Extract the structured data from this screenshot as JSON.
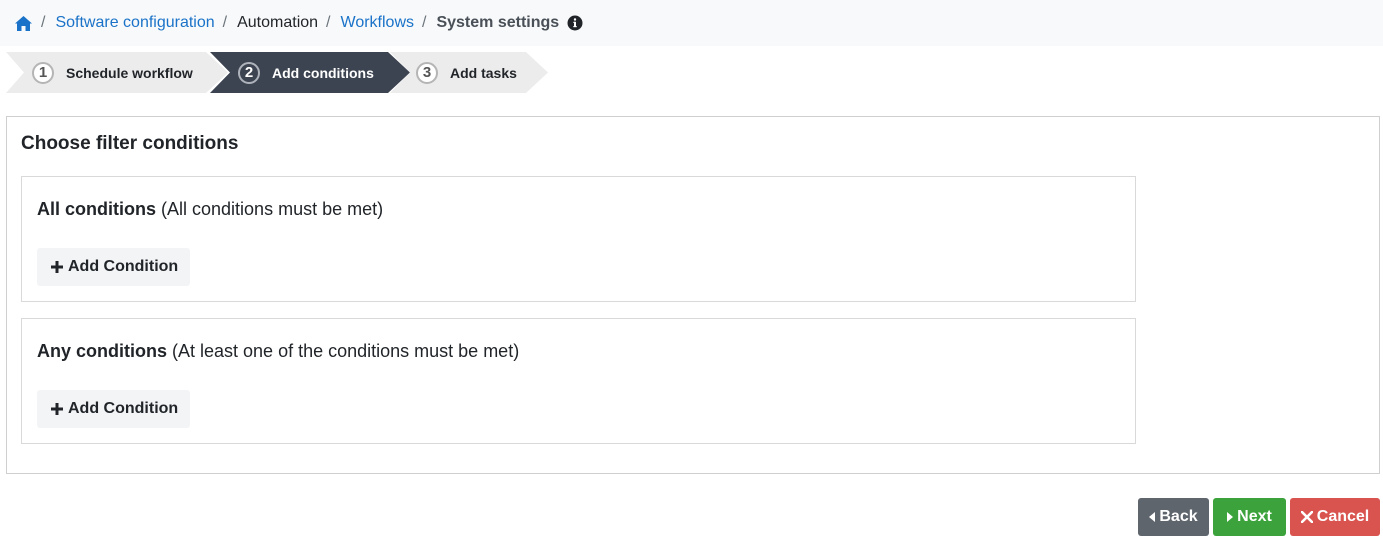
{
  "breadcrumb": {
    "home_icon": "home-icon",
    "items": [
      "Software configuration",
      "Automation",
      "Workflows",
      "System settings"
    ],
    "separator": "/",
    "info_icon": "info-circle-icon"
  },
  "steps": [
    {
      "number": "1",
      "label": "Schedule workflow",
      "state": "done"
    },
    {
      "number": "2",
      "label": "Add conditions",
      "state": "active"
    },
    {
      "number": "3",
      "label": "Add tasks",
      "state": "pending"
    }
  ],
  "panel": {
    "title": "Choose filter conditions",
    "groups": [
      {
        "title": "All conditions",
        "subtitle": "(All conditions must be met)",
        "button": "Add Condition"
      },
      {
        "title": "Any conditions",
        "subtitle": "(At least one of the conditions must be met)",
        "button": "Add Condition"
      }
    ]
  },
  "footer": {
    "back": "Back",
    "next": "Next",
    "cancel": "Cancel"
  },
  "colors": {
    "link": "#1a73c9",
    "active_step": "#3d4451",
    "back": "#5f656d",
    "next": "#3ca33c",
    "cancel": "#d9534f"
  }
}
